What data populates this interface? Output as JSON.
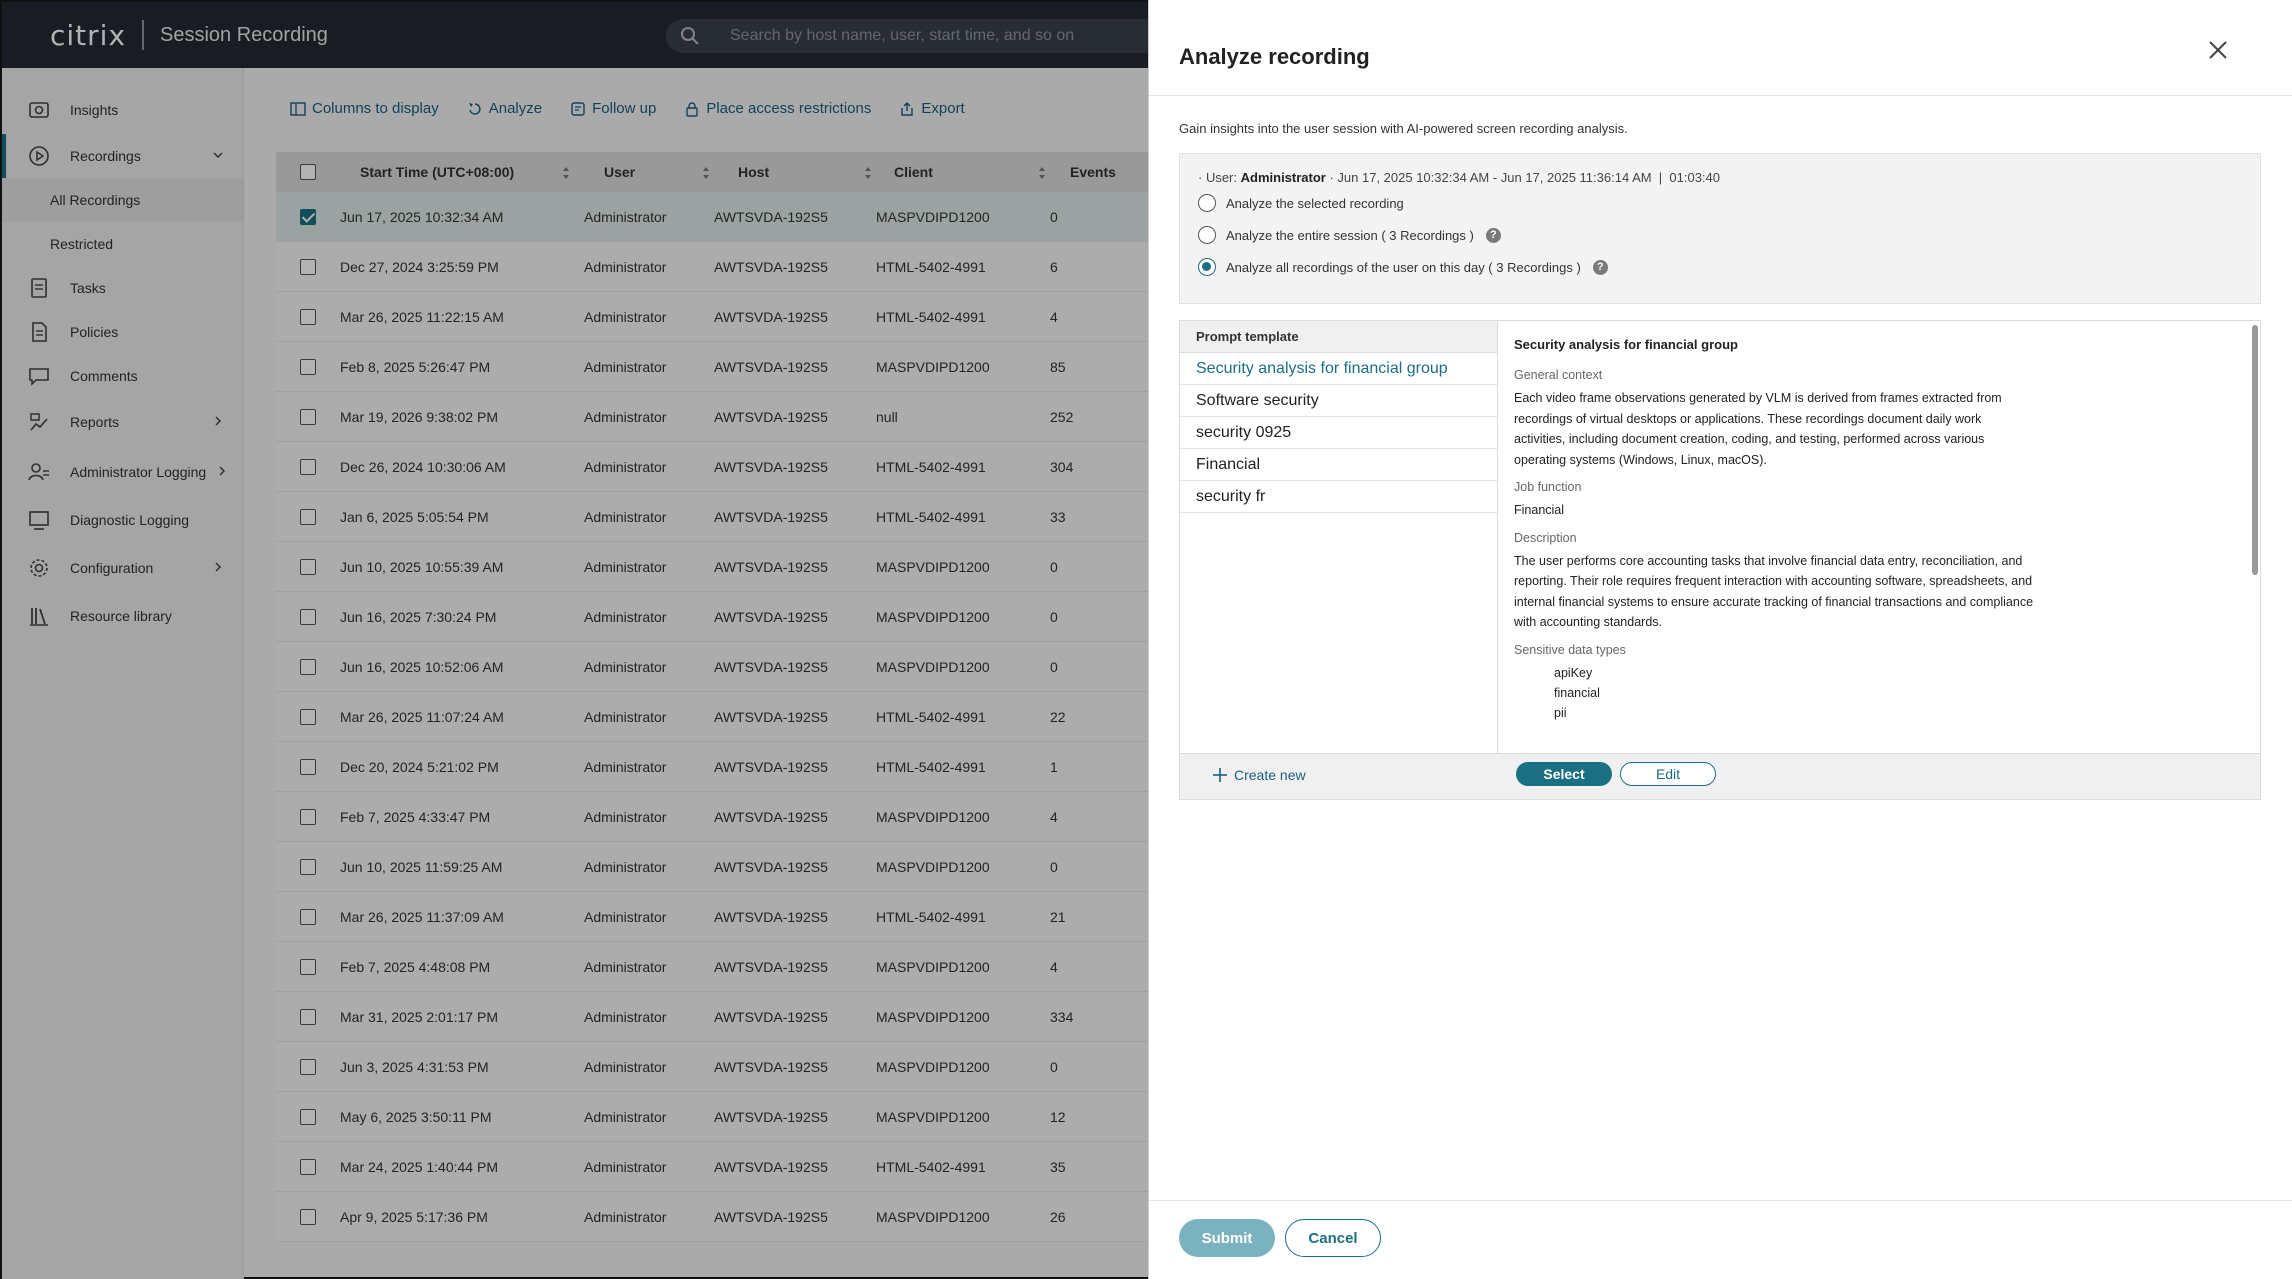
{
  "app": {
    "brand_logo": "citrix",
    "brand_product": "Session Recording",
    "search_placeholder": "Search by host name, user, start time, and so on"
  },
  "sidebar": {
    "items": [
      {
        "label": "Insights",
        "icon": "insights-icon"
      },
      {
        "label": "Recordings",
        "icon": "play-circle-icon"
      },
      {
        "label": "All Recordings"
      },
      {
        "label": "Restricted"
      },
      {
        "label": "Tasks",
        "icon": "tasks-icon"
      },
      {
        "label": "Policies",
        "icon": "policies-icon"
      },
      {
        "label": "Comments",
        "icon": "comments-icon"
      },
      {
        "label": "Reports",
        "icon": "reports-icon"
      },
      {
        "label": "Administrator Logging",
        "icon": "admin-logging-icon"
      },
      {
        "label": "Diagnostic Logging",
        "icon": "diagnostic-logging-icon"
      },
      {
        "label": "Configuration",
        "icon": "gear-icon"
      },
      {
        "label": "Resource library",
        "icon": "library-icon"
      }
    ]
  },
  "toolbar": {
    "columns": "Columns to display",
    "analyze": "Analyze",
    "follow_up": "Follow up",
    "restrictions": "Place access restrictions",
    "export": "Export"
  },
  "table": {
    "headers": {
      "start": "Start Time (UTC+08:00)",
      "user": "User",
      "host": "Host",
      "client": "Client",
      "events": "Events"
    },
    "rows": [
      {
        "start": "Jun 17, 2025 10:32:34 AM",
        "user": "Administrator",
        "host": "AWTSVDA-192S5",
        "client": "MASPVDIPD1200",
        "events": "0",
        "selected": true
      },
      {
        "start": "Dec 27, 2024 3:25:59 PM",
        "user": "Administrator",
        "host": "AWTSVDA-192S5",
        "client": "HTML-5402-4991",
        "events": "6"
      },
      {
        "start": "Mar 26, 2025 11:22:15 AM",
        "user": "Administrator",
        "host": "AWTSVDA-192S5",
        "client": "HTML-5402-4991",
        "events": "4"
      },
      {
        "start": "Feb 8, 2025 5:26:47 PM",
        "user": "Administrator",
        "host": "AWTSVDA-192S5",
        "client": "MASPVDIPD1200",
        "events": "85"
      },
      {
        "start": "Mar 19, 2026 9:38:02 PM",
        "user": "Administrator",
        "host": "AWTSVDA-192S5",
        "client": "null",
        "events": "252"
      },
      {
        "start": "Dec 26, 2024 10:30:06 AM",
        "user": "Administrator",
        "host": "AWTSVDA-192S5",
        "client": "HTML-5402-4991",
        "events": "304"
      },
      {
        "start": "Jan 6, 2025 5:05:54 PM",
        "user": "Administrator",
        "host": "AWTSVDA-192S5",
        "client": "HTML-5402-4991",
        "events": "33"
      },
      {
        "start": "Jun 10, 2025 10:55:39 AM",
        "user": "Administrator",
        "host": "AWTSVDA-192S5",
        "client": "MASPVDIPD1200",
        "events": "0"
      },
      {
        "start": "Jun 16, 2025 7:30:24 PM",
        "user": "Administrator",
        "host": "AWTSVDA-192S5",
        "client": "MASPVDIPD1200",
        "events": "0"
      },
      {
        "start": "Jun 16, 2025 10:52:06 AM",
        "user": "Administrator",
        "host": "AWTSVDA-192S5",
        "client": "MASPVDIPD1200",
        "events": "0"
      },
      {
        "start": "Mar 26, 2025 11:07:24 AM",
        "user": "Administrator",
        "host": "AWTSVDA-192S5",
        "client": "HTML-5402-4991",
        "events": "22"
      },
      {
        "start": "Dec 20, 2024 5:21:02 PM",
        "user": "Administrator",
        "host": "AWTSVDA-192S5",
        "client": "HTML-5402-4991",
        "events": "1"
      },
      {
        "start": "Feb 7, 2025 4:33:47 PM",
        "user": "Administrator",
        "host": "AWTSVDA-192S5",
        "client": "MASPVDIPD1200",
        "events": "4"
      },
      {
        "start": "Jun 10, 2025 11:59:25 AM",
        "user": "Administrator",
        "host": "AWTSVDA-192S5",
        "client": "MASPVDIPD1200",
        "events": "0"
      },
      {
        "start": "Mar 26, 2025 11:37:09 AM",
        "user": "Administrator",
        "host": "AWTSVDA-192S5",
        "client": "HTML-5402-4991",
        "events": "21"
      },
      {
        "start": "Feb 7, 2025 4:48:08 PM",
        "user": "Administrator",
        "host": "AWTSVDA-192S5",
        "client": "MASPVDIPD1200",
        "events": "4"
      },
      {
        "start": "Mar 31, 2025 2:01:17 PM",
        "user": "Administrator",
        "host": "AWTSVDA-192S5",
        "client": "MASPVDIPD1200",
        "events": "334"
      },
      {
        "start": "Jun 3, 2025 4:31:53 PM",
        "user": "Administrator",
        "host": "AWTSVDA-192S5",
        "client": "MASPVDIPD1200",
        "events": "0"
      },
      {
        "start": "May 6, 2025 3:50:11 PM",
        "user": "Administrator",
        "host": "AWTSVDA-192S5",
        "client": "MASPVDIPD1200",
        "events": "12"
      },
      {
        "start": "Mar 24, 2025 1:40:44 PM",
        "user": "Administrator",
        "host": "AWTSVDA-192S5",
        "client": "HTML-5402-4991",
        "events": "35"
      },
      {
        "start": "Apr 9, 2025 5:17:36 PM",
        "user": "Administrator",
        "host": "AWTSVDA-192S5",
        "client": "MASPVDIPD1200",
        "events": "26"
      }
    ]
  },
  "drawer": {
    "title": "Analyze recording",
    "intro": "Gain insights into the user session with AI-powered screen recording analysis.",
    "session": {
      "prefix": "· User: ",
      "user": "Administrator",
      "details": " · Jun 17, 2025 10:32:34 AM - Jun 17, 2025 11:36:14 AM  |  01:03:40"
    },
    "options": [
      {
        "label": "Analyze the selected recording",
        "checked": false,
        "help": false
      },
      {
        "label": "Analyze the entire session ( 3 Recordings )",
        "checked": false,
        "help": true
      },
      {
        "label": "Analyze all recordings of the user on this day ( 3 Recordings )",
        "checked": true,
        "help": true
      }
    ],
    "help_glyph": "?",
    "templates": {
      "header": "Prompt template",
      "items": [
        "Security analysis for financial group",
        "Software security",
        "security 0925",
        "Financial",
        "security fr"
      ],
      "active_index": 0,
      "create_new": "Create new",
      "select": "Select",
      "edit": "Edit"
    },
    "preview": {
      "title": "Security analysis for financial group",
      "general_context_label": "General context",
      "general_context": "Each video frame observations generated by VLM is derived from frames extracted from recordings of virtual desktops or applications. These recordings document daily work activities, including document creation, coding, and testing, performed across various operating systems (Windows, Linux, macOS).",
      "job_function_label": "Job function",
      "job_function": "Financial",
      "description_label": "Description",
      "description": "The user performs core accounting tasks that involve financial data entry, reconciliation, and reporting. Their role requires frequent interaction with accounting software, spreadsheets, and internal financial systems to ensure accurate tracking of financial transactions and compliance with accounting standards.",
      "sensitive_label": "Sensitive data types",
      "sensitive_types": [
        "apiKey",
        "financial",
        "pii"
      ]
    },
    "submit": "Submit",
    "cancel": "Cancel"
  },
  "colors": {
    "accent": "#1b6f82",
    "topbar": "#242a33",
    "link": "#1b5e80"
  }
}
